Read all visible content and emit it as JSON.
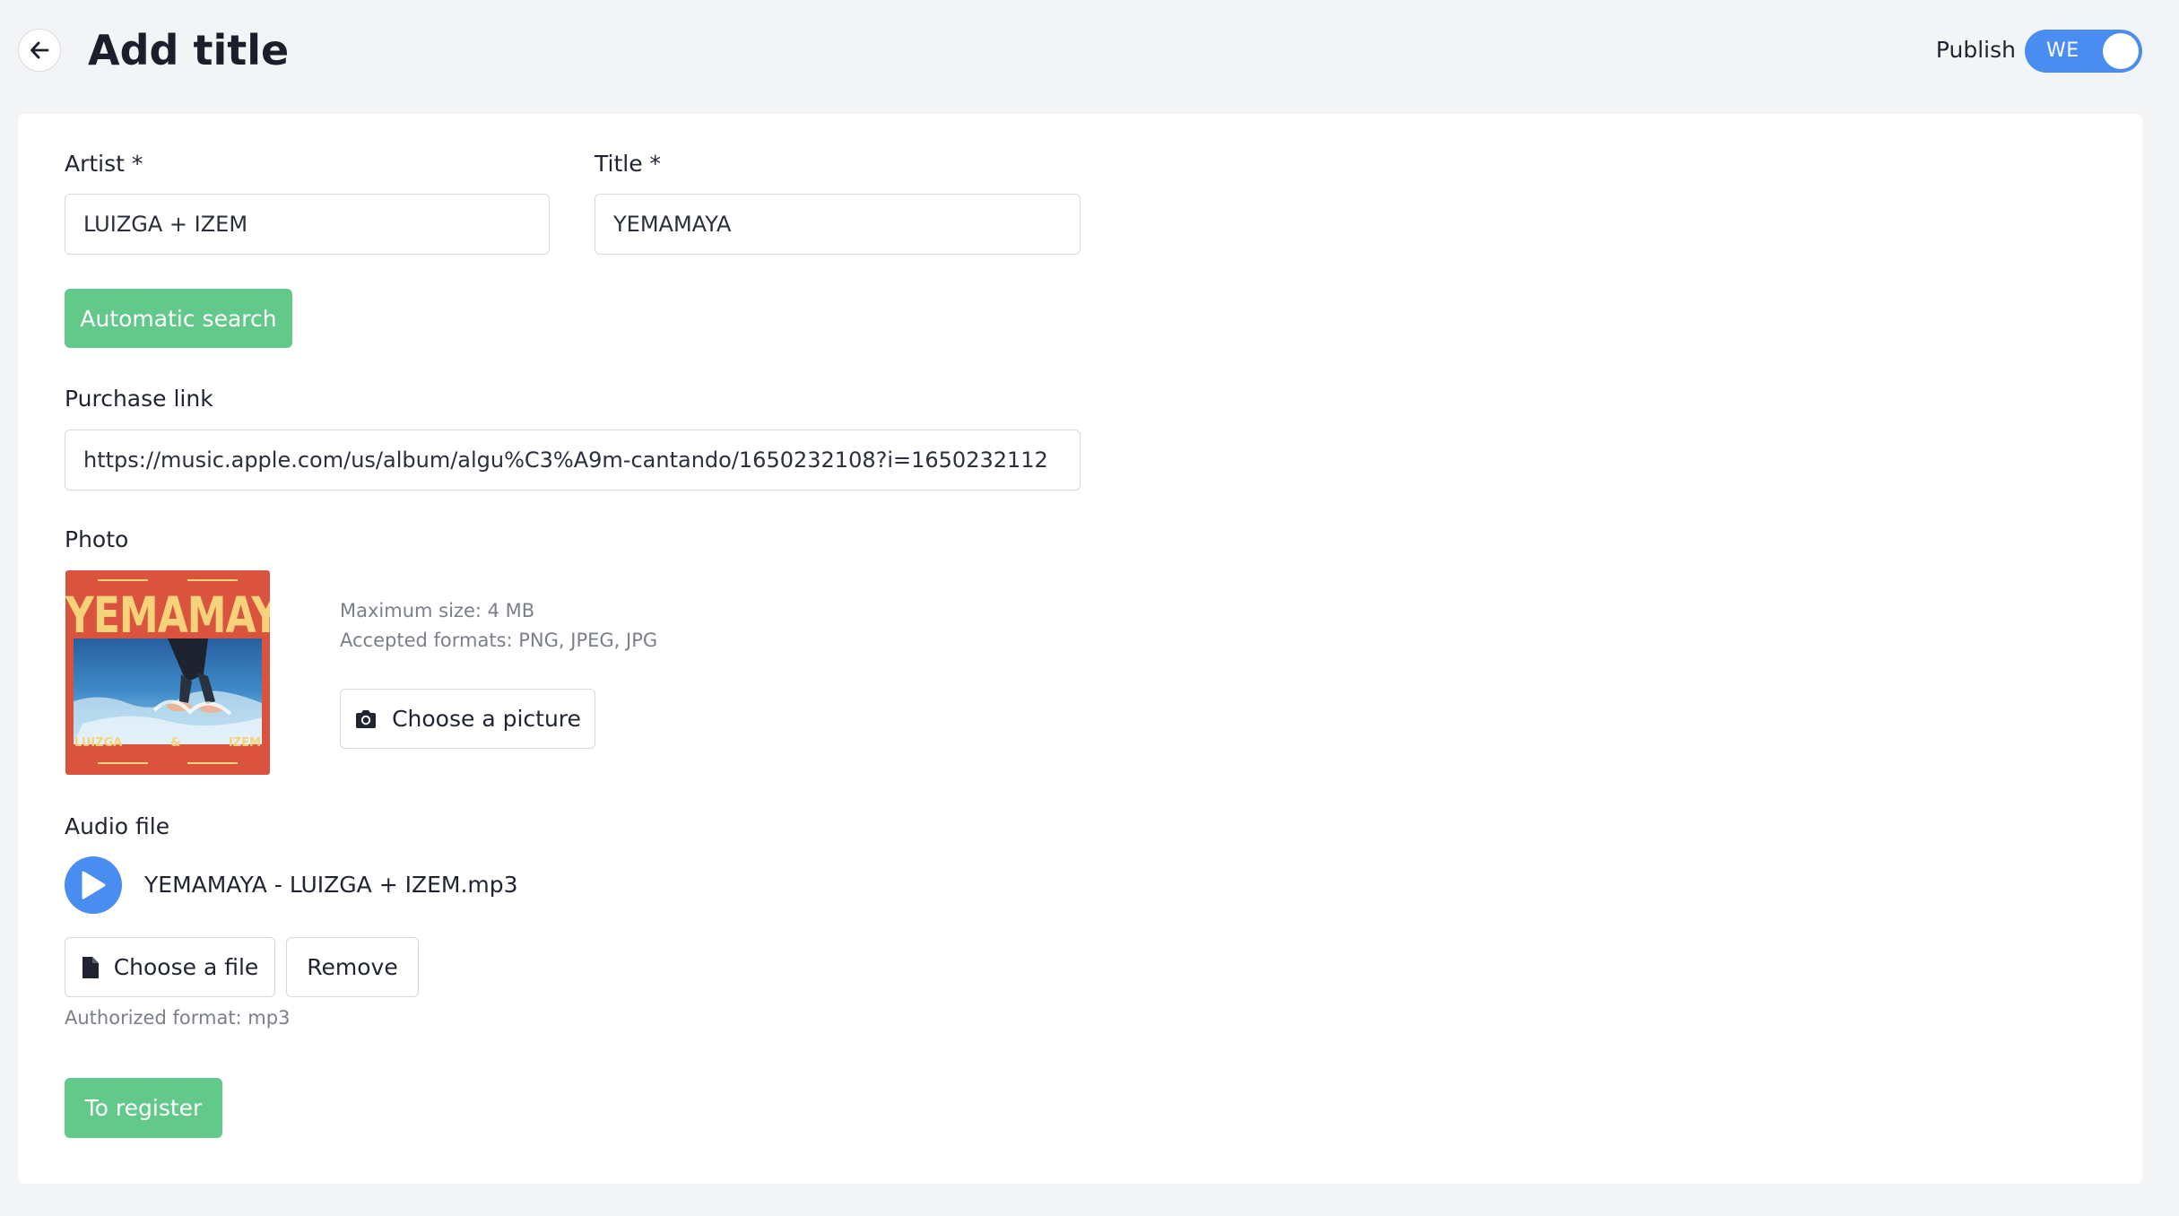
{
  "header": {
    "title": "Add title",
    "publish_label": "Publish",
    "publish_toggle_text": "WE"
  },
  "form": {
    "artist": {
      "label": "Artist *",
      "value": "LUIZGA + IZEM"
    },
    "title": {
      "label": "Title *",
      "value": "YEMAMAYA"
    },
    "automatic_search_label": "Automatic search",
    "purchase_link": {
      "label": "Purchase link",
      "value": "https://music.apple.com/us/album/algu%C3%A9m-cantando/1650232108?i=1650232112"
    },
    "photo": {
      "label": "Photo",
      "cover_title": "YEMAMAYA",
      "cover_left": "LUIZGA",
      "cover_mid": "&",
      "cover_right": "IZEM",
      "max_size": "Maximum size: 4 MB",
      "accepted_formats": "Accepted formats: PNG, JPEG, JPG",
      "choose_label": "Choose a picture"
    },
    "audio": {
      "label": "Audio file",
      "file_name": "YEMAMAYA - LUIZGA + IZEM.mp3",
      "choose_label": "Choose a file",
      "remove_label": "Remove",
      "authorized_format": "Authorized format: mp3"
    },
    "register_label": "To register"
  },
  "colors": {
    "background": "#f3f4f6",
    "accent_blue": "#4a8df0",
    "accent_green": "#62c98a",
    "cover_red": "#d9533f",
    "cover_yellow": "#f6d27a"
  }
}
